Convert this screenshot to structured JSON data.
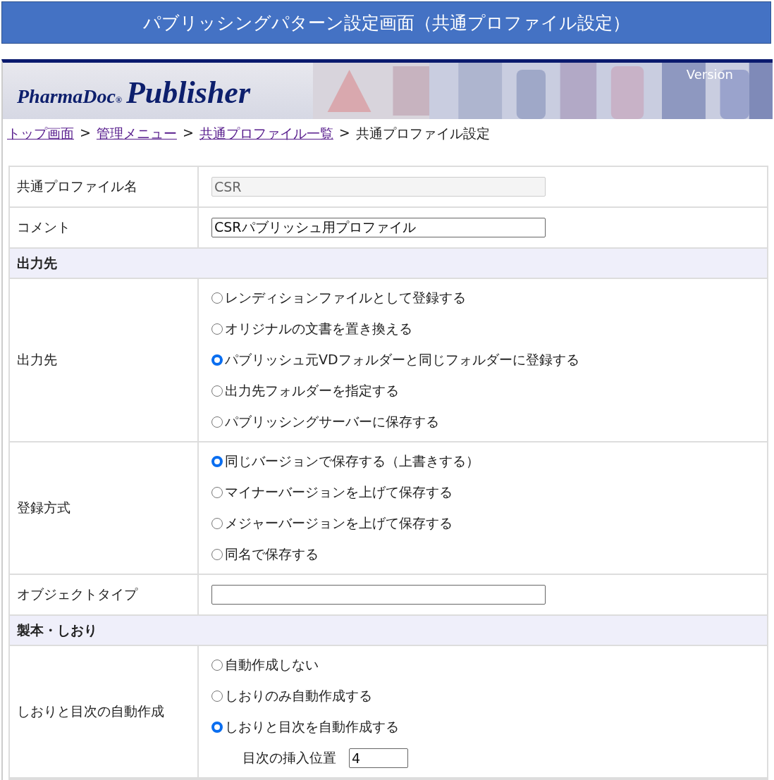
{
  "title": "パブリッシングパターン設定画面（共通プロファイル設定）",
  "banner": {
    "logo_brand": "PharmaDoc",
    "logo_mark": "®",
    "logo_product": "Publisher",
    "version": "Version"
  },
  "breadcrumb": [
    {
      "label": "トップ画面",
      "link": true
    },
    {
      "label": "管理メニュー",
      "link": true
    },
    {
      "label": "共通プロファイル一覧",
      "link": true
    },
    {
      "label": "共通プロファイル設定",
      "link": false
    }
  ],
  "breadcrumb_separator": ">",
  "rows": [
    {
      "kind": "text",
      "label": "共通プロファイル名",
      "value": "CSR",
      "disabled": true
    },
    {
      "kind": "text",
      "label": "コメント",
      "value": "CSRパブリッシュ用プロファイル",
      "disabled": false
    },
    {
      "kind": "section",
      "label": "出力先"
    },
    {
      "kind": "radio",
      "label": "出力先",
      "options": [
        {
          "label": "レンディションファイルとして登録する",
          "selected": false
        },
        {
          "label": "オリジナルの文書を置き換える",
          "selected": false
        },
        {
          "label": "パブリッシュ元VDフォルダーと同じフォルダーに登録する",
          "selected": true
        },
        {
          "label": "出力先フォルダーを指定する",
          "selected": false
        },
        {
          "label": "パブリッシングサーバーに保存する",
          "selected": false
        }
      ]
    },
    {
      "kind": "radio",
      "label": "登録方式",
      "options": [
        {
          "label": "同じバージョンで保存する（上書きする）",
          "selected": true
        },
        {
          "label": "マイナーバージョンを上げて保存する",
          "selected": false
        },
        {
          "label": "メジャーバージョンを上げて保存する",
          "selected": false
        },
        {
          "label": "同名で保存する",
          "selected": false
        }
      ]
    },
    {
      "kind": "text",
      "label": "オブジェクトタイプ",
      "disabled": false
    },
    {
      "kind": "section",
      "label": "製本・しおり"
    },
    {
      "kind": "radio",
      "label": "しおりと目次の自動作成",
      "options": [
        {
          "label": "自動作成しない",
          "selected": false
        },
        {
          "label": "しおりのみ自動作成する",
          "selected": false
        },
        {
          "label": "しおりと目次を自動作成する",
          "selected": true
        }
      ],
      "extra": {
        "label": "目次の挿入位置",
        "value": "4"
      }
    }
  ]
}
